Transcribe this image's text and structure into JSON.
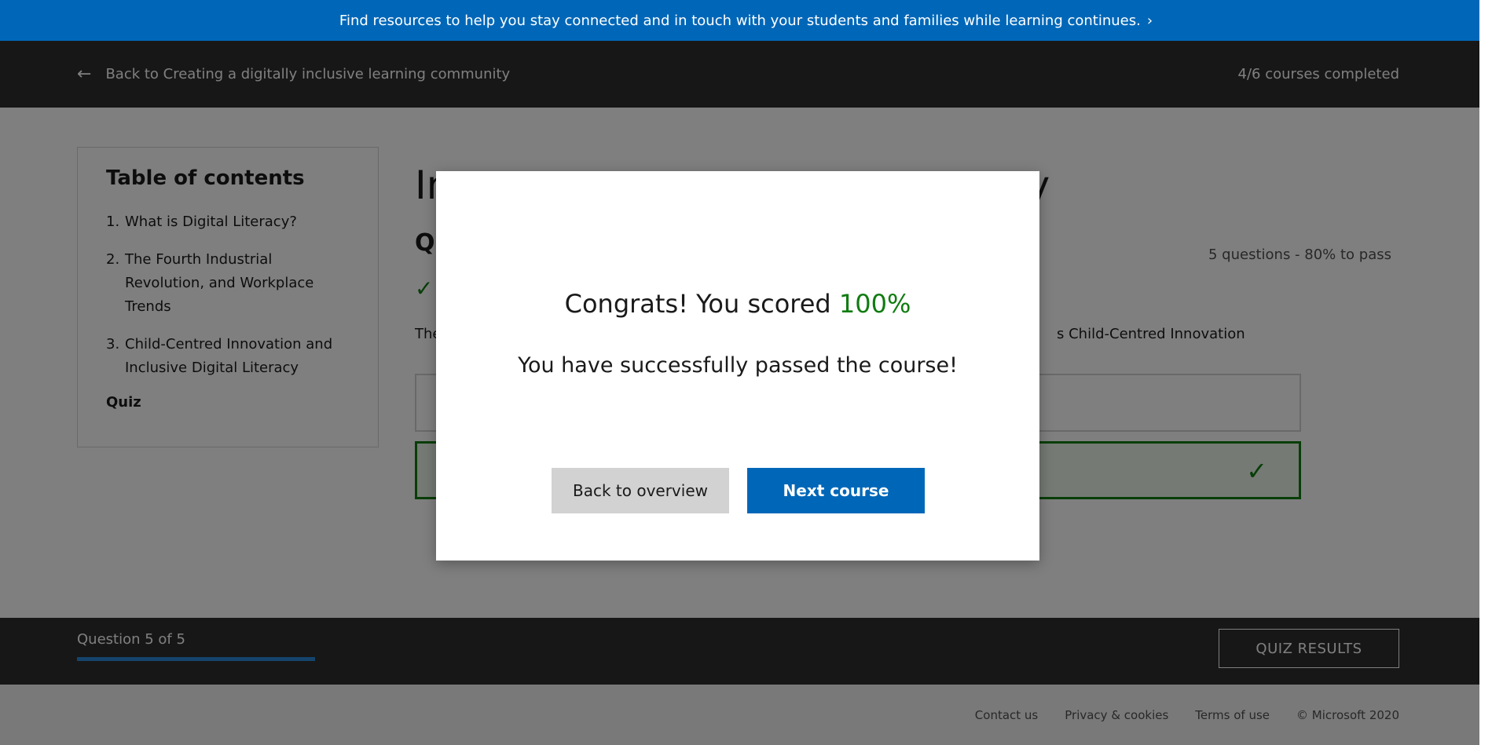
{
  "banner": {
    "text": "Find resources to help you stay connected and in touch with your students and families while learning continues.",
    "chevron": "›"
  },
  "navbar": {
    "back_text": "Back to Creating a digitally inclusive learning community",
    "progress_text": "4/6 courses completed",
    "back_icon": "arrow-left-icon"
  },
  "toc": {
    "title": "Table of contents",
    "items": [
      {
        "num": "1.",
        "label": "What is Digital Literacy?"
      },
      {
        "num": "2.",
        "label": "The Fourth Industrial Revolution, and Workplace Trends"
      },
      {
        "num": "3.",
        "label": "Child-Centred Innovation and Inclusive Digital Literacy"
      }
    ],
    "quiz_label": "Quiz"
  },
  "content": {
    "title_head": "In",
    "title_tail": "racy",
    "quiz_heading": "Qu",
    "quiz_meta": "5 questions - 80% to pass",
    "question_head": "The",
    "question_tail": "s Child-Centred Innovation"
  },
  "footer_bar": {
    "progress_label": "Question 5 of 5",
    "progress_fraction": 1.0,
    "results_button": "QUIZ RESULTS"
  },
  "site_footer": {
    "links": [
      "Contact us",
      "Privacy & cookies",
      "Terms of use",
      "© Microsoft 2020"
    ]
  },
  "modal": {
    "score_prefix": "Congrats! You scored",
    "score_value": "100%",
    "message": "You have successfully passed the course!",
    "back_button": "Back to overview",
    "next_button": "Next course"
  },
  "colors": {
    "brand_blue": "#0067b8",
    "success_green": "#107c10",
    "dark_bar": "#2f2f2f"
  }
}
